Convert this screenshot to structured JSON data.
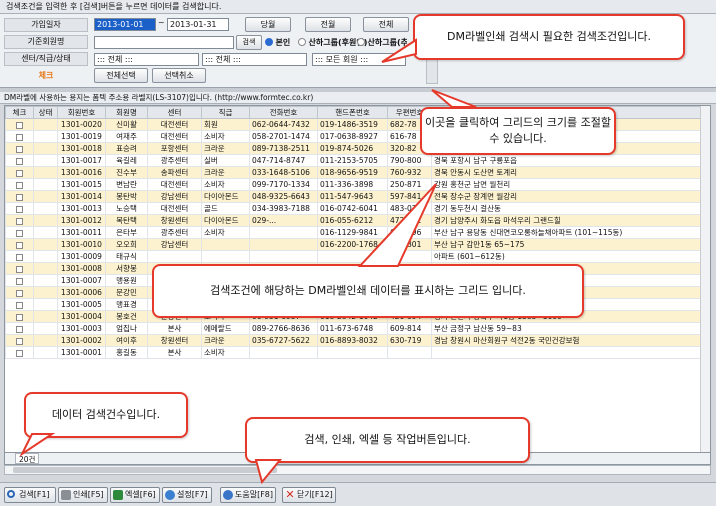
{
  "header": {
    "instruction": "검색조건을 입력한 후 [검색]버튼을 누르면 데이터를 검색합니다."
  },
  "search": {
    "join_date_label": "가입일자",
    "date_from": "2013-01-01",
    "date_to": "2013-01-31",
    "tilde": "~",
    "btn_month": "당월",
    "btn_prev_month": "전월",
    "btn_all": "전체",
    "base_member_label": "기준회원명",
    "btn_search_small": "검색",
    "radio_self": "본인",
    "radio_sub_group": "산하그룹(후원인)",
    "radio_sub_group2": "산하그룹(추천인)",
    "center_label": "센터/직급/상태",
    "center_value": "::: 전체 :::",
    "rank_value": "::: 전체 :::",
    "status_value": "::: 모든 회원 :::",
    "check_label": "체크",
    "btn_select_all": "전체선택",
    "btn_deselect": "선택취소"
  },
  "grid": {
    "title": "DM라벨에 사용하는 용지는 폼텍 주소용 라벨지(LS-3107)입니다. (http://www.formtec.co.kr)",
    "columns": [
      "체크",
      "상태",
      "회원번호",
      "회원명",
      "센터",
      "직급",
      "전화번호",
      "핸드폰번호",
      "우편번호",
      "주소"
    ],
    "rows": [
      [
        "",
        "1301-0020",
        "신미활",
        "대전센터",
        "회원",
        "062-0644-7432",
        "019-1486-3519",
        "682-78",
        ""
      ],
      [
        "",
        "1301-0019",
        "여재주",
        "대전센터",
        "소비자",
        "058-2701-1474",
        "017-0638-8927",
        "616-78",
        ""
      ],
      [
        "",
        "1301-0018",
        "표승려",
        "포항센터",
        "크라운",
        "089-7138-2511",
        "019-874-5026",
        "320-82",
        ""
      ],
      [
        "",
        "1301-0017",
        "육길레",
        "광주센터",
        "실버",
        "047-714-8747",
        "011-2153-5705",
        "790-800",
        "경북 포항시 남구 구룡포읍"
      ],
      [
        "",
        "1301-0016",
        "진수부",
        "송파센터",
        "크라운",
        "033-1648-5106",
        "018-9656-9519",
        "760-932",
        "경북 안동시 도산면 토계리"
      ],
      [
        "",
        "1301-0015",
        "변남란",
        "대전센터",
        "소비자",
        "099-7170-1334",
        "011-336-3898",
        "250-871",
        "강원 홍천군 남면 월천리"
      ],
      [
        "",
        "1301-0014",
        "봉탄박",
        "강남센터",
        "다이아몬드",
        "048-9325-6643",
        "011-547-9643",
        "597-841",
        "전북 장수군 장계면 월강리"
      ],
      [
        "",
        "1301-0013",
        "노승택",
        "대전센터",
        "골드",
        "034-3983-7188",
        "016-0742-6041",
        "483-070",
        "경기 동두천시 걸산동"
      ],
      [
        "",
        "1301-0012",
        "목탄택",
        "창원센터",
        "다이아몬드",
        "029-...",
        "016-055-6212",
        "472-782",
        "경기 남양주시 화도읍 마석우리 그랜드힐"
      ],
      [
        "",
        "1301-0011",
        "은타부",
        "광주센터",
        "소비자",
        "",
        "016-1129-9841",
        "608-796",
        "부산 남구 용당동 신대연코오롱하늘채아파트 (101~115동)"
      ],
      [
        "",
        "1301-0010",
        "오오희",
        "강남센터",
        "",
        "",
        "016-2200-1768",
        "608-801",
        "부산 남구 감만1동 65~175"
      ],
      [
        "",
        "1301-0009",
        "태규식",
        "",
        "",
        "",
        "",
        "",
        "아파트 (601~612동)"
      ],
      [
        "",
        "1301-0008",
        "서향봉",
        "",
        "",
        "",
        "",
        "",
        ""
      ],
      [
        "",
        "1301-0007",
        "맹용원",
        "",
        "",
        "",
        "",
        "",
        ""
      ],
      [
        "",
        "1301-0006",
        "문강민",
        "",
        "",
        "",
        "",
        "",
        ""
      ],
      [
        "",
        "1301-0005",
        "맹표경",
        "",
        "",
        "",
        "",
        "",
        ""
      ],
      [
        "",
        "1301-0004",
        "봉호건",
        "분당센터",
        "소비자",
        "06-951-6937",
        "018-2842-1042",
        "426-894",
        "경기 안산시 상록구 사1동 1583~1600"
      ],
      [
        "",
        "1301-0003",
        "엄집나",
        "본사",
        "에메랄드",
        "089-2766-8636",
        "011-673-6748",
        "609-814",
        "부산 금정구 남산동 59~83"
      ],
      [
        "",
        "1301-0002",
        "여이후",
        "창원센터",
        "크라운",
        "035-6727-5622",
        "016-8893-8032",
        "630-719",
        "경남 창원시 마산회원구 석전2동 국민건강보험"
      ],
      [
        "",
        "1301-0001",
        "홍길동",
        "본사",
        "소비자",
        "",
        "",
        "",
        ""
      ]
    ]
  },
  "status": {
    "count": "20건"
  },
  "toolbar": {
    "search": "검색[F1]",
    "print": "인쇄[F5]",
    "excel": "엑셀[F6]",
    "settings": "설정[F7]",
    "help": "도움말[F8]",
    "close": "닫기[F12]"
  },
  "callouts": {
    "search_cond": "DM라벨인쇄 검색시 필요한 검색조건입니다.",
    "grid_resize": "이곳을 클릭하여 그리드의 크기를 조절할 수 있습니다.",
    "grid_desc": "검색조건에 해당하는 DM라벨인쇄 데이터를 표시하는 그리드 입니다.",
    "count_desc": "데이터 검색건수입니다.",
    "buttons_desc": "검색, 인쇄, 엑셀 등 작업버튼입니다."
  },
  "colors": {
    "callout_border": "#e53a2b",
    "row_highlight": "#fdf2cf",
    "check_label": "#e87a1a"
  }
}
